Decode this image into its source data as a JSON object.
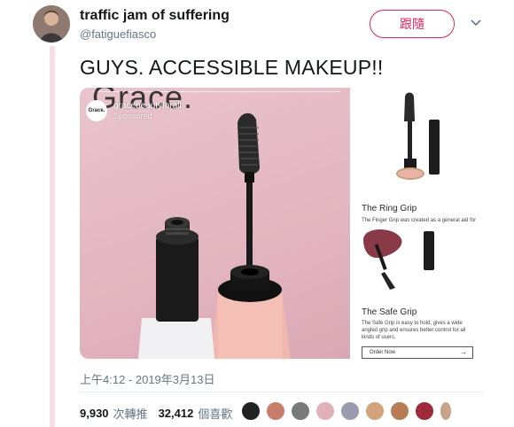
{
  "author": {
    "name": "traffic jam of suffering",
    "handle": "@fatiguefiasco"
  },
  "follow_button": {
    "label": "跟隨"
  },
  "tweet": {
    "text": "GUYS. ACCESSIBLE MAKEUP!!"
  },
  "media": {
    "brand_overlay": "Grace.",
    "sponsor_logo_text": "Grace.",
    "sponsor_name": "gracebeautyforall",
    "sponsor_label": "Sponsored",
    "side_panel": {
      "section1_title": "The Ring Grip",
      "section1_text": "The Finger Grip was created as a general aid for",
      "section2_title": "The Safe Grip",
      "section2_text": "The Safe Grip is easy to hold, gives a wide angled grip and ensures better control for all kinds of users.",
      "order_label": "Order Now"
    }
  },
  "timestamp": "上午4:12 - 2019年3月13日",
  "stats": {
    "retweets_count": "9,930",
    "retweets_label": "次轉推",
    "likes_count": "32,412",
    "likes_label": "個喜歡"
  },
  "likers": [
    "liker-1",
    "liker-2",
    "liker-3",
    "liker-4",
    "liker-5",
    "liker-6",
    "liker-7",
    "liker-8",
    "liker-9"
  ],
  "colors": {
    "accent": "#e0245e",
    "text_primary": "#14171a",
    "text_secondary": "#657786",
    "media_pink": "#e3b5c0"
  }
}
